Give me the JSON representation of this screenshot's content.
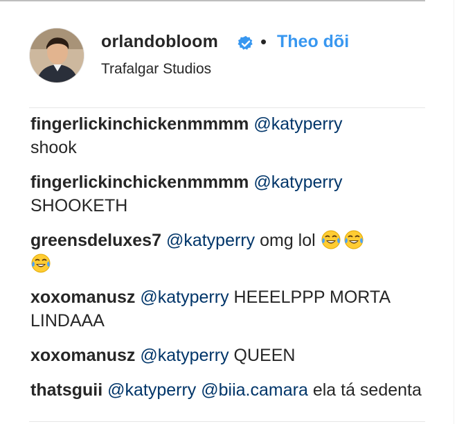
{
  "post_header": {
    "username": "orlandobloom",
    "separator": "•",
    "follow_label": "Theo dõi",
    "location": "Trafalgar Studios",
    "verified_icon": "verified-badge-icon"
  },
  "colors": {
    "follow_blue": "#3897f0",
    "mention_blue": "#003569",
    "text": "#262626"
  },
  "comments": [
    {
      "user": "fingerlickinchickenmmmm",
      "mention1": "@katyperry",
      "text": "shook"
    },
    {
      "user": "fingerlickinchickenmmmm",
      "mention1": "@katyperry",
      "text": "SHOOKETH"
    },
    {
      "user": "greensdeluxes7",
      "mention1": "@katyperry",
      "text": "omg lol",
      "emoji": "face-with-tears-of-joy"
    },
    {
      "user": "xoxomanusz",
      "mention1": "@katyperry",
      "text": "HEEELPPP MORTA LINDAAA"
    },
    {
      "user": "xoxomanusz",
      "mention1": "@katyperry",
      "text": "QUEEN"
    },
    {
      "user": "thatsguii",
      "mention1": "@katyperry",
      "mention2": "@biia.camara",
      "text": "ela tá sedenta"
    }
  ]
}
